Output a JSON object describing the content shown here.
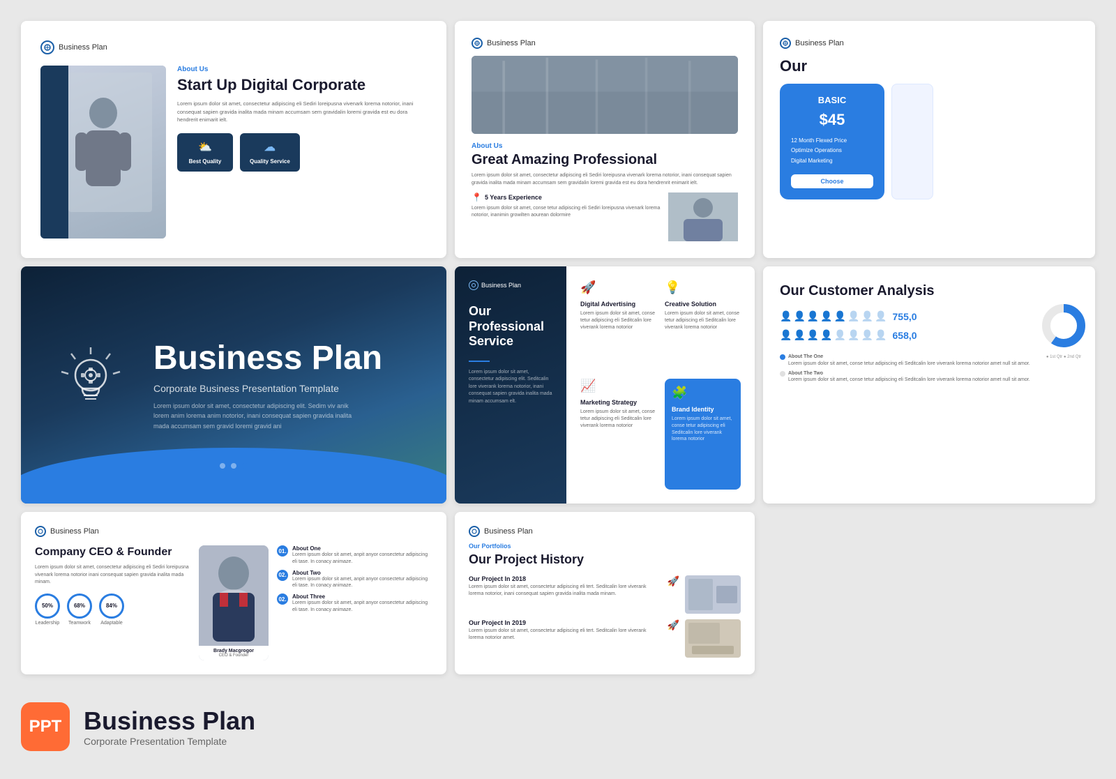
{
  "slides": {
    "slide1": {
      "logo": "Business Plan",
      "about_label": "About Us",
      "title": "Start Up Digital Corporate",
      "body": "Lorem ipsum dolor sit amet, consectetur adipiscing eli Sediri loreipusna vivenark lorema notorior, inani consequat sapien gravida inalita mada minam accumsam sem gravidalin loremi gravida est eu dora hendrerit enimarit ielt.",
      "btn1_label": "Best Quality",
      "btn2_label": "Quality Service"
    },
    "slide2": {
      "logo": "Business Plan",
      "about_label": "About Us",
      "title": "Great Amazing Professional",
      "body": "Lorem ipsum dolor sit amet, consectetur adipiscing eli Sediri loreipusna vivenark lorema notorior, inani consequat sapien gravida inalita mada minam accumsam sem gravidalin loremi gravida est eu dora hendrenrit enimarit ielt.",
      "experience_title": "5 Years Experience",
      "experience_text": "Lorem ipsum dolor sit amet, conse tetur adipiscing eli Sediri loreipusna vivenark lorema notorior, inanimin growilten aourean dolormire"
    },
    "slide3": {
      "logo": "Business Plan",
      "our_label": "Our",
      "plan_name": "BASIC",
      "price": "$45",
      "feature1": "12 Month Flexed Price",
      "feature2": "Optimize Operations",
      "feature3": "Digital Marketing",
      "choose_label": "Choose"
    },
    "slide4": {
      "title": "Business Plan",
      "subtitle": "Corporate Business Presentation Template",
      "body": "Lorem ipsum dolor sit amet, consectetur adipiscing elit. Sedim viv anik lorem anim lorema anim notorior, inani consequat sapien gravida inalita mada accumsam sem gravid loremi gravid ani"
    },
    "slide5": {
      "logo": "Business Plan",
      "service_title": "Our Professional Service",
      "service_body": "Lorem ipsum dolor sit amet, consectetur adipiscing elit. Seditcalin lore viverank lorema notorior, inani consequat sapien gravida inalita mada minam accumsam elt.",
      "item1_title": "Digital Advertising",
      "item1_text": "Lorem ipsum dolor sit amet, conse tetur adipiscing eli Seditcalin lore viverank lorema notorior",
      "item2_title": "Creative Solution",
      "item2_text": "Lorem ipsum dolor sit amet, conse tetur adipiscing eli Seditcalin lore viverank lorema notorior",
      "item3_title": "Marketing Strategy",
      "item3_text": "Lorem ipsum dolor sit amet, conse tetur adipiscing eli Seditcalin lore viverank lorema notorior",
      "item4_title": "Brand Identity",
      "item4_text": "Lorem ipsum dolor sit amet, conse tetur adipiscing eli Seditcalin lore viverank lorema notorior"
    },
    "slide6": {
      "title": "Our Customer Analysis",
      "stat1_value": "755,0",
      "stat2_value": "658,0",
      "legend1_title": "About The One",
      "legend1_text": "Lorem ipsum dolor sit amet, conse tetur adipiscing eli Seditcalin lore viverank lorema notorior amet null sit amor.",
      "legend2_title": "About The Two",
      "legend2_text": "Lorem ipsum dolor sit amet, conse tetur adipiscing eli Seditcalin lore viverank lorema notorior amet null sit amor."
    },
    "slide7": {
      "logo": "Business Plan",
      "title": "Company CEO & Founder",
      "body": "Lorem ipsum dolor sit amet, consectetur adipiscing eli Sediri loreipusna vivenark lorema notorior inani consequat sapien gravida inalita mada minam.",
      "stat1": "50%",
      "stat1_label": "Leadership",
      "stat2": "68%",
      "stat2_label": "Teamwork",
      "stat3": "84%",
      "stat3_label": "Adaptable",
      "ceo_name": "Brady Macgrogor",
      "ceo_role": "CEO & Founder",
      "about1_title": "About One",
      "about1_text": "Lorem ipsum dolor sit amet, anpit anyor consectetur adipiscing eli tase. In conacy animaze.",
      "about2_title": "About Two",
      "about2_text": "Lorem ipsum dolor sit amet, anpit anyor consectetur adipiscing eli tase. In conacy animaze.",
      "about3_title": "About Three",
      "about3_text": "Lorem ipsum dolor sit amet, anpit anyor consectetur adipiscing eli tase. In conacy animaze."
    },
    "slide8": {
      "logo": "Business Plan",
      "portfolios_label": "Our Portfolios",
      "title": "Our Project History",
      "project1_year": "Our Project In 2018",
      "project1_text": "Lorem ipsum dolor sit amet, consectetur adipiscing eli tert. Seditcalin lore viverank lorema notorior, inani consequat sapien gravida inalita mada minam.",
      "project2_year": "Our Project In 2019",
      "project2_text": "Lorem ipsum dolor sit amet, consectetur adipiscing eli tert. Seditcalin lore viverank lorema notorior amet."
    }
  },
  "footer": {
    "ppt_label": "PPT",
    "title": "Business Plan",
    "subtitle": "Corporate Presentation Template"
  }
}
